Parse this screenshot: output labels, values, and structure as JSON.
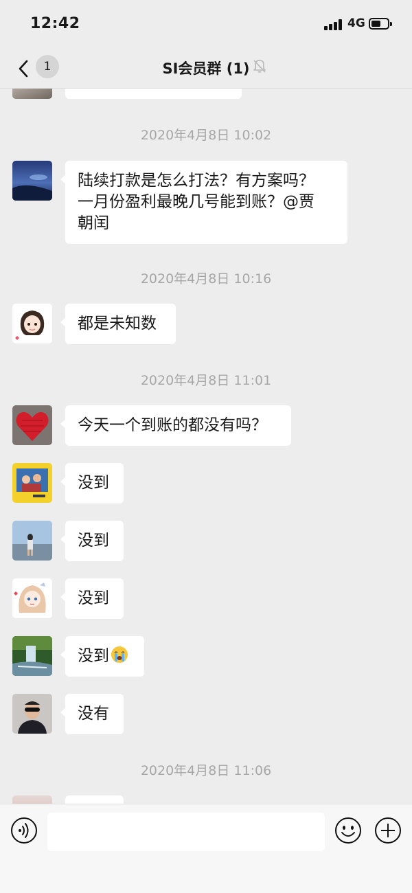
{
  "status_bar": {
    "time": "12:42",
    "network": "4G"
  },
  "nav": {
    "unread_count": "1",
    "title": "SI会员群 (1)"
  },
  "timestamps": {
    "t1": "2020年4月8日 10:02",
    "t2": "2020年4月8日 10:16",
    "t3": "2020年4月8日 11:01",
    "t4": "2020年4月8日 11:06"
  },
  "messages": {
    "m1": {
      "line1": "陆续打款是怎么打法？有方案吗？",
      "line2": "一月份盈利最晚几号能到账？@贾",
      "line3": "朝闰"
    },
    "m2": {
      "text": "都是未知数"
    },
    "m3": {
      "text": "今天一个到账的都没有吗？"
    },
    "m4": {
      "text": "没到"
    },
    "m5": {
      "text": "没到"
    },
    "m6": {
      "text": "没到"
    },
    "m7": {
      "text": "没到"
    },
    "m8": {
      "text": "没有"
    }
  },
  "icons": {
    "back": "chevron-left-icon",
    "mute": "bell-off-icon",
    "voice": "voice-icon",
    "emoji": "smiley-icon",
    "plus": "plus-icon",
    "crying_emoji": "crying-face-emoji"
  },
  "colors": {
    "background": "#ededed",
    "bubble": "#ffffff",
    "timestamp": "#a7a7a7",
    "text": "#191919"
  },
  "input": {
    "value": ""
  }
}
